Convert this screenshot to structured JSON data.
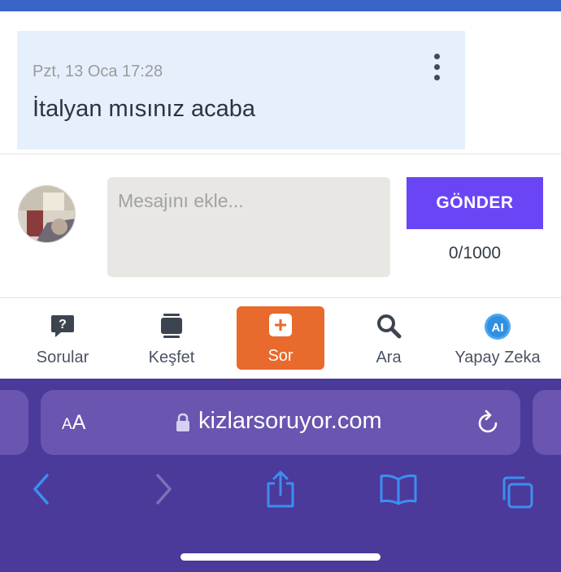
{
  "message": {
    "date": "Pzt, 13 Oca 17:28",
    "text": "İtalyan mısınız acaba",
    "menu_icon": "more-vertical-icon"
  },
  "composer": {
    "placeholder": "Mesajını ekle...",
    "value": "",
    "send_label": "GÖNDER",
    "char_count": "0/1000"
  },
  "nav": {
    "items": [
      {
        "label": "Sorular",
        "icon": "question-bubble-icon"
      },
      {
        "label": "Keşfet",
        "icon": "cards-icon"
      },
      {
        "label": "Sor",
        "icon": "plus-square-icon"
      },
      {
        "label": "Ara",
        "icon": "search-icon"
      },
      {
        "label": "Yapay Zeka",
        "icon": "ai-icon"
      }
    ]
  },
  "browser": {
    "aa_label": "AA",
    "url": "kizlarsoruyor.com"
  },
  "colors": {
    "accent_purple": "#6a45f5",
    "sor_orange": "#e86a2c",
    "safari_bar": "#4b3a9a",
    "message_bg": "#e6effc"
  }
}
